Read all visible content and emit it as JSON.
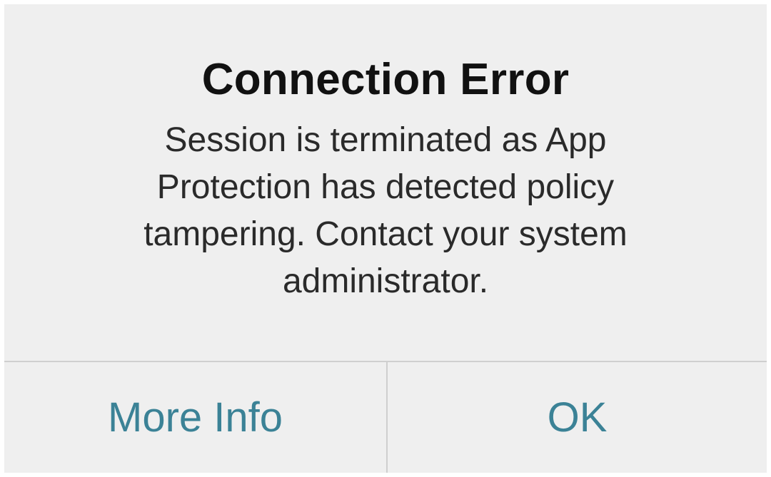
{
  "alert": {
    "title": "Connection Error",
    "message": "Session is terminated as App Protection has detected policy tampering. Contact your system administrator.",
    "buttons": {
      "more_info": "More Info",
      "ok": "OK"
    }
  },
  "colors": {
    "background": "#efefef",
    "button_text": "#3b8296",
    "title_text": "#111111",
    "divider": "#cfcfcf"
  }
}
